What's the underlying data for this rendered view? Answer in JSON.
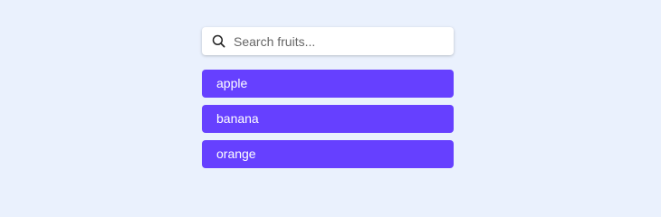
{
  "search": {
    "placeholder": "Search fruits...",
    "value": ""
  },
  "fruits": [
    {
      "label": "apple"
    },
    {
      "label": "banana"
    },
    {
      "label": "orange"
    }
  ],
  "colors": {
    "background": "#eaf1fd",
    "item_background": "#6640ff",
    "item_text": "#ffffff"
  }
}
